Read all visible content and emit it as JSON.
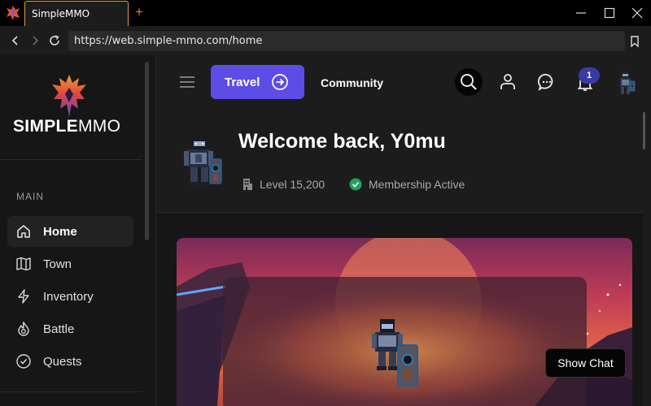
{
  "browser": {
    "tab_title": "SimpleMMO",
    "new_tab_icon": "plus-icon",
    "url": "https://web.simple-mmo.com/home"
  },
  "sidebar": {
    "brand_bold": "SIMPLE",
    "brand_light": "MMO",
    "section_label": "MAIN",
    "items": [
      {
        "label": "Home",
        "icon": "home-icon",
        "active": true
      },
      {
        "label": "Town",
        "icon": "map-icon",
        "active": false
      },
      {
        "label": "Inventory",
        "icon": "lightning-icon",
        "active": false
      },
      {
        "label": "Battle",
        "icon": "flame-icon",
        "active": false
      },
      {
        "label": "Quests",
        "icon": "check-circle-icon",
        "active": false
      }
    ]
  },
  "topnav": {
    "travel_label": "Travel",
    "community_label": "Community",
    "notification_count": "1"
  },
  "welcome": {
    "title": "Welcome back, Y0mu",
    "level": "Level 15,200",
    "membership": "Membership Active"
  },
  "chat": {
    "show_chat_label": "Show Chat"
  },
  "colors": {
    "accent": "#5b4de5",
    "tab_border": "#e69a3c",
    "membership_check": "#1fa35c",
    "badge": "#3a3aa5"
  }
}
